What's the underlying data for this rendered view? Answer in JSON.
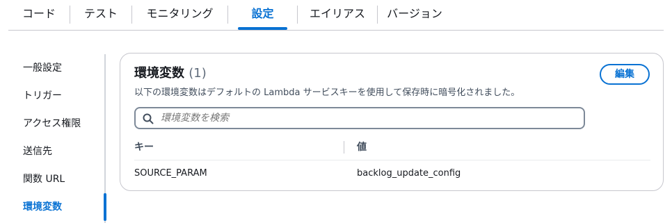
{
  "tabs": [
    {
      "label": "コード"
    },
    {
      "label": "テスト"
    },
    {
      "label": "モニタリング"
    },
    {
      "label": "設定",
      "active": true
    },
    {
      "label": "エイリアス"
    },
    {
      "label": "バージョン"
    }
  ],
  "sidebar": {
    "items": [
      {
        "label": "一般設定"
      },
      {
        "label": "トリガー"
      },
      {
        "label": "アクセス権限"
      },
      {
        "label": "送信先"
      },
      {
        "label": "関数 URL"
      },
      {
        "label": "環境変数",
        "active": true
      }
    ]
  },
  "env_panel": {
    "title": "環境変数",
    "count": "(1)",
    "description": "以下の環境変数はデフォルトの Lambda サービスキーを使用して保存時に暗号化されました。",
    "edit_label": "編集",
    "search": {
      "placeholder": "環境変数を検索",
      "icon": "search-icon"
    },
    "table": {
      "headers": {
        "key": "キー",
        "value": "値"
      },
      "rows": [
        {
          "key": "SOURCE_PARAM",
          "value": "backlog_update_config"
        }
      ]
    }
  },
  "colors": {
    "accent": "#0972d3",
    "border": "#c6c6cd",
    "text": "#16191f"
  }
}
